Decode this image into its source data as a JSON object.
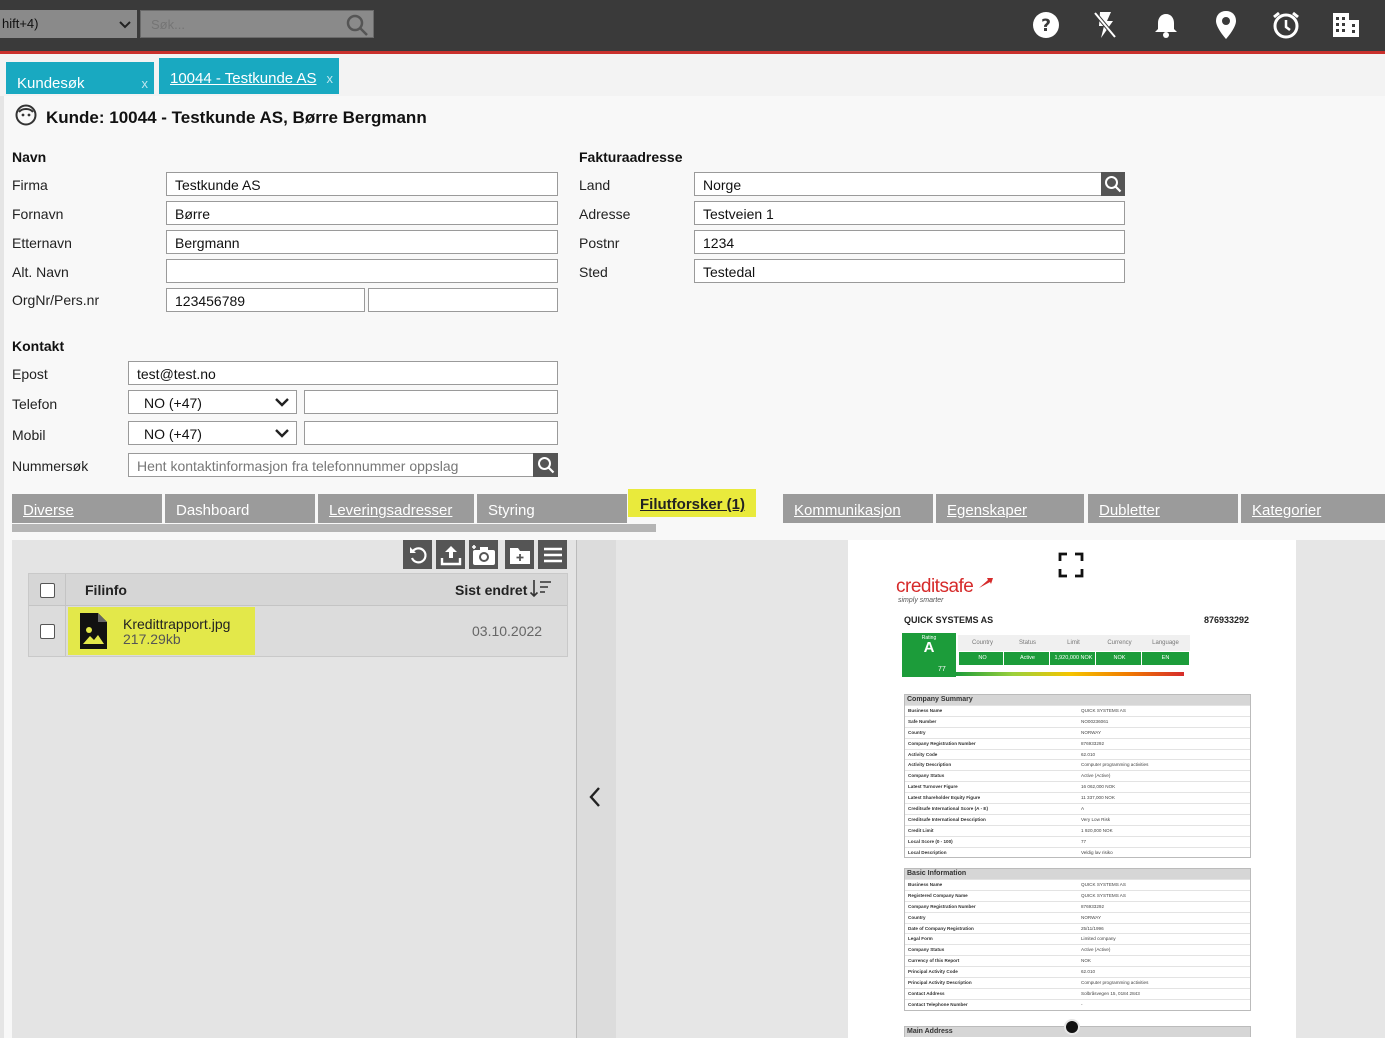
{
  "topbar": {
    "shortcut_text": "hift+4)",
    "search_placeholder": "Søk...",
    "icons": [
      "help-icon",
      "flash-off-icon",
      "bell-icon",
      "location-icon",
      "alarm-icon",
      "building-icon"
    ]
  },
  "tabs": [
    {
      "label": "Kundesøk",
      "close": "x"
    },
    {
      "label": "10044 - Testkunde AS",
      "close": "x"
    }
  ],
  "customer": {
    "title": "Kunde: 10044 - Testkunde AS, Børre Bergmann",
    "navn": {
      "heading": "Navn",
      "firma_label": "Firma",
      "firma": "Testkunde AS",
      "fornavn_label": "Fornavn",
      "fornavn": "Børre",
      "etternavn_label": "Etternavn",
      "etternavn": "Bergmann",
      "altnavn_label": "Alt. Navn",
      "altnavn": "",
      "orgnr_label": "OrgNr/Pers.nr",
      "orgnr": "123456789",
      "orgnr2": ""
    },
    "faktura": {
      "heading": "Fakturaadresse",
      "land_label": "Land",
      "land": "Norge",
      "adresse_label": "Adresse",
      "adresse": "Testveien 1",
      "postnr_label": "Postnr",
      "postnr": "1234",
      "sted_label": "Sted",
      "sted": "Testedal"
    },
    "kontakt": {
      "heading": "Kontakt",
      "epost_label": "Epost",
      "epost": "test@test.no",
      "telefon_label": "Telefon",
      "telefon_code": "NO (+47)",
      "telefon": "",
      "mobil_label": "Mobil",
      "mobil_code": "NO (+47)",
      "mobil": "",
      "nummersok_label": "Nummersøk",
      "nummersok_placeholder": "Hent kontaktinformasjon fra telefonnummer oppslag"
    }
  },
  "subtabs": [
    {
      "label": "Diverse"
    },
    {
      "label": "Dashboard"
    },
    {
      "label": "Leveringsadresser"
    },
    {
      "label": "Styring"
    },
    {
      "label": "Filutforsker (1)",
      "active": true
    },
    {
      "label": "Kommunikasjon"
    },
    {
      "label": "Egenskaper"
    },
    {
      "label": "Dubletter"
    },
    {
      "label": "Kategorier"
    }
  ],
  "files": {
    "col_info": "Filinfo",
    "col_changed": "Sist endret",
    "rows": [
      {
        "name": "Kredittrapport.jpg",
        "size": "217.29kb",
        "date": "03.10.2022"
      }
    ]
  },
  "report": {
    "brand": "creditsafe",
    "tagline": "simply smarter",
    "company": "QUICK SYSTEMS AS",
    "number": "876933292",
    "rating_label": "Rating",
    "rating": "A",
    "rating_score": "77",
    "rating_cols": [
      {
        "h": "Country",
        "v": "NO"
      },
      {
        "h": "Status",
        "v": "Active"
      },
      {
        "h": "Limit",
        "v": "1,920,000 NOK"
      },
      {
        "h": "Currency",
        "v": "NOK"
      },
      {
        "h": "Language",
        "v": "EN"
      }
    ],
    "summary": {
      "title": "Company Summary",
      "rows": [
        {
          "k": "Business Name",
          "v": "QUICK SYSTEMS AS"
        },
        {
          "k": "Safe Number",
          "v": "NO00236061"
        },
        {
          "k": "Country",
          "v": "NORWAY"
        },
        {
          "k": "Company Registration Number",
          "v": "876933292"
        },
        {
          "k": "Activity Code",
          "v": "62.010"
        },
        {
          "k": "Activity Description",
          "v": "Computer programming activities"
        },
        {
          "k": "Company Status",
          "v": "Active (Active)"
        },
        {
          "k": "Latest Turnover Figure",
          "v": "16 062,000 NOK"
        },
        {
          "k": "Latest Shareholder Equity Figure",
          "v": "11 337,000 NOK"
        },
        {
          "k": "Creditsafe International Score (A - E)",
          "v": "A"
        },
        {
          "k": "Creditsafe International Description",
          "v": "Very Low Risk"
        },
        {
          "k": "Credit Limit",
          "v": "1 920,000 NOK"
        },
        {
          "k": "Local Score (0 - 100)",
          "v": "77"
        },
        {
          "k": "Local Description",
          "v": "Veldig lav risiko"
        }
      ]
    },
    "basic": {
      "title": "Basic Information",
      "rows": [
        {
          "k": "Business Name",
          "v": "QUICK SYSTEMS AS"
        },
        {
          "k": "Registered Company Name",
          "v": "QUICK SYSTEMS AS"
        },
        {
          "k": "Company Registration Number",
          "v": "876933292"
        },
        {
          "k": "Country",
          "v": "NORWAY"
        },
        {
          "k": "Date of Company Registration",
          "v": "25/11/1996"
        },
        {
          "k": "Legal Form",
          "v": "Limited company"
        },
        {
          "k": "Company Status",
          "v": "Active (Active)"
        },
        {
          "k": "Currency of this Report",
          "v": "NOK"
        },
        {
          "k": "Principal Activity Code",
          "v": "62.010"
        },
        {
          "k": "Principal Activity Description",
          "v": "Computer programming activities"
        },
        {
          "k": "Contact Address",
          "v": "Solbråsvegen 15, 0184 2843"
        },
        {
          "k": "Contact Telephone Number",
          "v": "-"
        }
      ]
    },
    "main_address_title": "Main Address"
  },
  "colors": {
    "topbar": "#3a3a3a",
    "tab": "#19a9c1",
    "highlight": "#e3e84a",
    "accent_red": "#c9302c"
  }
}
